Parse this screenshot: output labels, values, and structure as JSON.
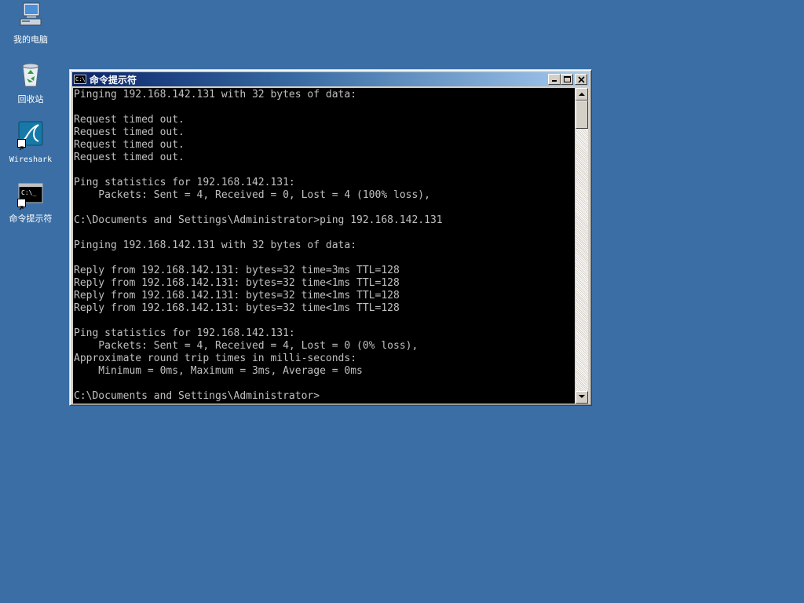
{
  "desktop": {
    "icons": [
      {
        "label": "我的电脑",
        "icon": "my-computer-icon"
      },
      {
        "label": "回收站",
        "icon": "recycle-bin-icon"
      },
      {
        "label": "Wireshark",
        "icon": "wireshark-icon"
      },
      {
        "label": "命令提示符",
        "icon": "command-prompt-icon"
      }
    ],
    "background_color": "#3a6ea5"
  },
  "window": {
    "title": "命令提示符",
    "icon_text": "C:\\",
    "titlebar_color": "#0a246a",
    "console_lines": [
      "Pinging 192.168.142.131 with 32 bytes of data:",
      "",
      "Request timed out.",
      "Request timed out.",
      "Request timed out.",
      "Request timed out.",
      "",
      "Ping statistics for 192.168.142.131:",
      "    Packets: Sent = 4, Received = 0, Lost = 4 (100% loss),",
      "",
      "C:\\Documents and Settings\\Administrator>ping 192.168.142.131",
      "",
      "Pinging 192.168.142.131 with 32 bytes of data:",
      "",
      "Reply from 192.168.142.131: bytes=32 time=3ms TTL=128",
      "Reply from 192.168.142.131: bytes=32 time<1ms TTL=128",
      "Reply from 192.168.142.131: bytes=32 time<1ms TTL=128",
      "Reply from 192.168.142.131: bytes=32 time<1ms TTL=128",
      "",
      "Ping statistics for 192.168.142.131:",
      "    Packets: Sent = 4, Received = 4, Lost = 0 (0% loss),",
      "Approximate round trip times in milli-seconds:",
      "    Minimum = 0ms, Maximum = 3ms, Average = 0ms",
      "",
      "C:\\Documents and Settings\\Administrator>"
    ]
  }
}
